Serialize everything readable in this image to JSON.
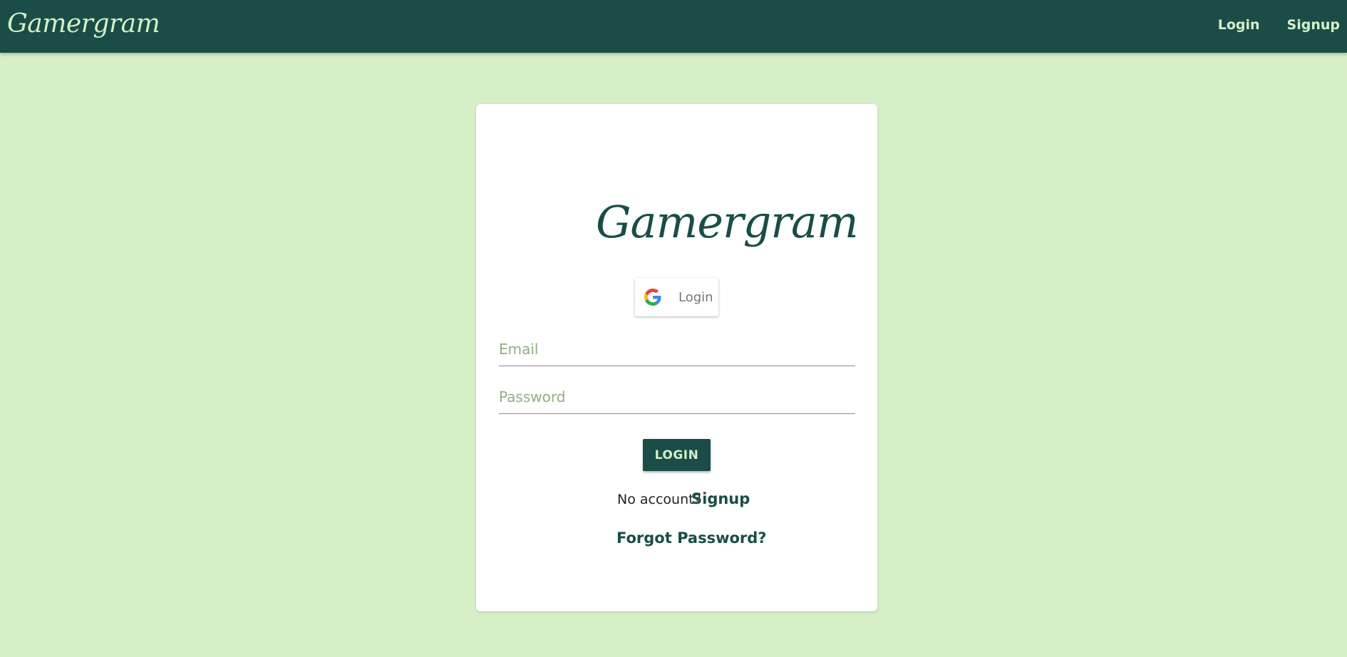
{
  "navbar": {
    "brand": "Gamergram",
    "links": {
      "login": "Login",
      "signup": "Signup"
    }
  },
  "card": {
    "logo": "Gamergram",
    "google_button": {
      "icon": "google-icon",
      "label": "Login"
    },
    "email_field": {
      "placeholder": "Email",
      "value": ""
    },
    "password_field": {
      "placeholder": "Password",
      "value": ""
    },
    "login_button": "LOGIN",
    "no_account_text": "No account?",
    "signup_link": "Signup",
    "forgot_password_link": "Forgot Password?"
  },
  "colors": {
    "primary": "#1a4d48",
    "background": "#d6efc7",
    "accent_text": "#d6efc7",
    "placeholder": "#8db080"
  }
}
